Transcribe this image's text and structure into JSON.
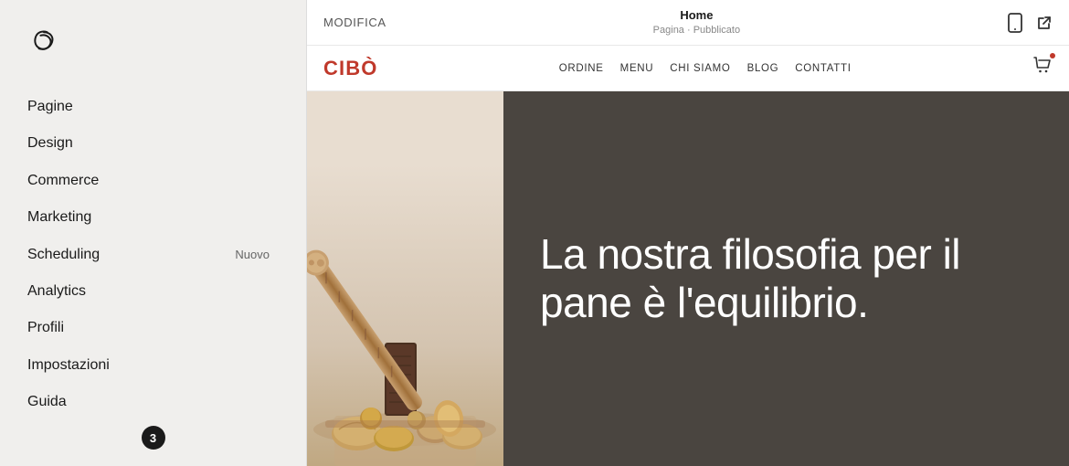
{
  "sidebar": {
    "logo_alt": "Squarespace Logo",
    "nav_items": [
      {
        "label": "Pagine",
        "badge": ""
      },
      {
        "label": "Design",
        "badge": ""
      },
      {
        "label": "Commerce",
        "badge": ""
      },
      {
        "label": "Marketing",
        "badge": ""
      },
      {
        "label": "Scheduling",
        "badge": "Nuovo"
      },
      {
        "label": "Analytics",
        "badge": ""
      },
      {
        "label": "Profili",
        "badge": ""
      },
      {
        "label": "Impostazioni",
        "badge": ""
      },
      {
        "label": "Guida",
        "badge": ""
      }
    ],
    "bottom_badge": "3"
  },
  "topbar": {
    "modifica_label": "MODIFICA",
    "page_name": "Home",
    "page_status": "Pagina · Pubblicato"
  },
  "website": {
    "brand": "CIBÒ",
    "nav_links": [
      "ORDINE",
      "MENU",
      "CHI SIAMO",
      "BLOG",
      "CONTATTI"
    ],
    "headline": "La nostra filosofia per il pane è l'equilibrio."
  },
  "icons": {
    "mobile": "📱",
    "external_link": "↗",
    "cart": "🛒"
  }
}
